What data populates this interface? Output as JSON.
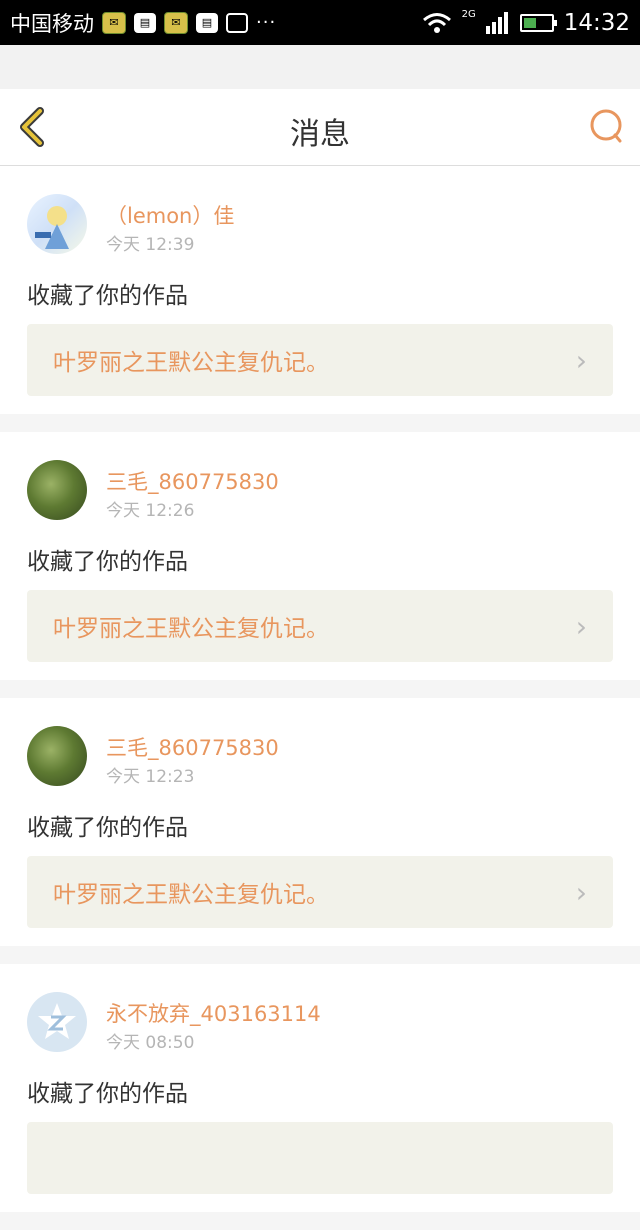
{
  "status_bar": {
    "carrier": "中国移动",
    "network": "2G",
    "time": "14:32",
    "dots": "···"
  },
  "header": {
    "title": "消息",
    "back_icon": "chevron-left-icon",
    "search_icon": "search-icon"
  },
  "messages": [
    {
      "user": "（lemon）佳",
      "time": "今天 12:39",
      "action": "收藏了你的作品",
      "work": "叶罗丽之王默公主复仇记。"
    },
    {
      "user": "三毛_860775830",
      "time": "今天 12:26",
      "action": "收藏了你的作品",
      "work": "叶罗丽之王默公主复仇记。"
    },
    {
      "user": "三毛_860775830",
      "time": "今天 12:23",
      "action": "收藏了你的作品",
      "work": "叶罗丽之王默公主复仇记。"
    },
    {
      "user": "永不放弃_403163114",
      "time": "今天 08:50",
      "action": "收藏了你的作品",
      "work": ""
    }
  ],
  "colors": {
    "accent": "#e8965e",
    "back_icon": "#e6c33a"
  }
}
